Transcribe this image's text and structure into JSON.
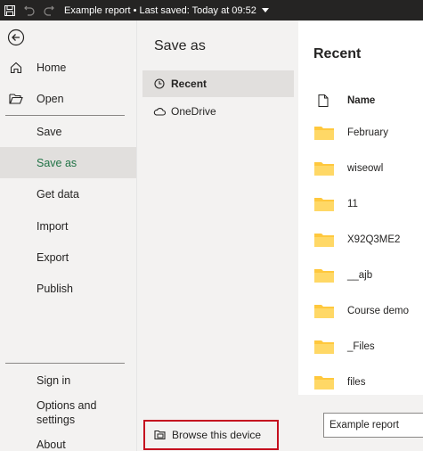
{
  "titlebar": {
    "title": "Example report • Last saved: Today at 09:52",
    "icons": [
      "save-icon",
      "undo-icon",
      "redo-icon",
      "dropdown-caret-icon"
    ]
  },
  "nav": {
    "back_icon": "back-arrow-icon",
    "home": "Home",
    "open": "Open",
    "save": "Save",
    "save_as": "Save as",
    "get_data": "Get data",
    "import": "Import",
    "export": "Export",
    "publish": "Publish",
    "sign_in": "Sign in",
    "options_line1": "Options and",
    "options_line2": "settings",
    "about": "About"
  },
  "save_as": {
    "title": "Save as",
    "locations": [
      {
        "label": "Recent",
        "icon": "clock-icon"
      },
      {
        "label": "OneDrive",
        "icon": "cloud-icon"
      }
    ],
    "browse_label": "Browse this device"
  },
  "recent": {
    "title": "Recent",
    "column_name": "Name",
    "files": [
      {
        "name": "February",
        "icon": "folder-icon"
      },
      {
        "name": "wiseowl",
        "icon": "folder-icon"
      },
      {
        "name": "11",
        "icon": "folder-icon"
      },
      {
        "name": "X92Q3ME2",
        "icon": "folder-icon"
      },
      {
        "name": "__ajb",
        "icon": "folder-icon"
      },
      {
        "name": "Course demo",
        "icon": "folder-icon"
      },
      {
        "name": "_Files",
        "icon": "folder-icon"
      },
      {
        "name": "files",
        "icon": "folder-icon"
      }
    ],
    "filename_value": "Example report"
  },
  "colors": {
    "titlebar_bg": "#252423",
    "nav_bg": "#f3f2f1",
    "active_bg": "#e1dfdd",
    "active_text": "#217346",
    "folder": "#ffc83d",
    "highlight_border": "#c50f1f"
  }
}
